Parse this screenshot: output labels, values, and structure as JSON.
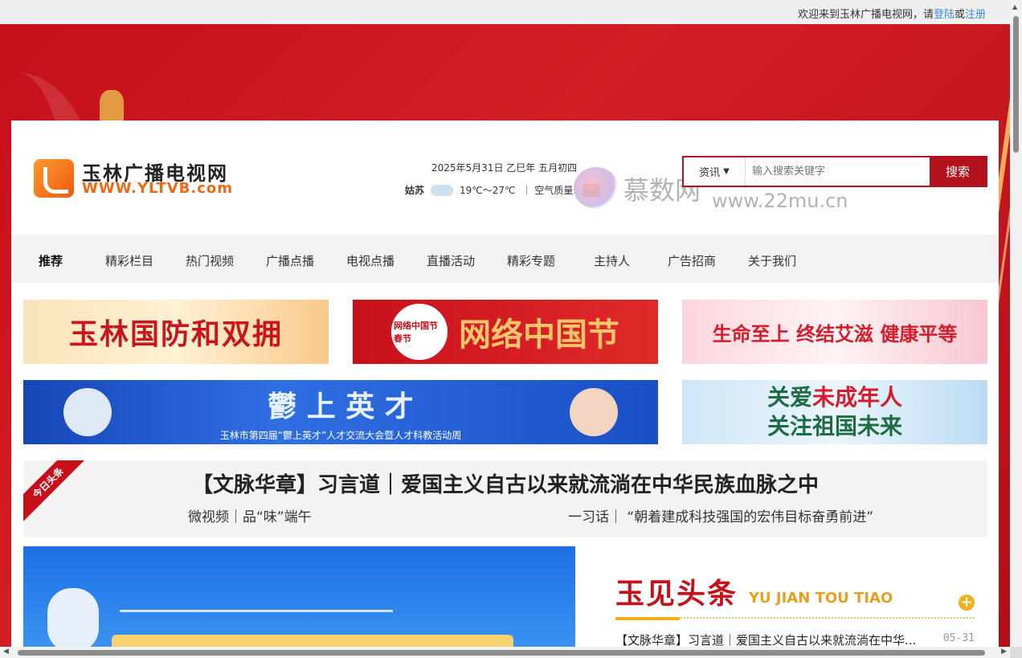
{
  "topbar": {
    "welcome_prefix": "欢迎来到玉林广播电视网，请",
    "login": "登陆",
    "or": "或",
    "register": "注册"
  },
  "logo": {
    "name_cn": "玉林广播电视网",
    "name_en": "WWW.YLTVB.com"
  },
  "date_info": {
    "date": "2025年5月31日  乙巳年  五月初四"
  },
  "weather": {
    "city": "姑苏",
    "temp": "19℃～27℃",
    "aq_label": "｜ 空气质量:"
  },
  "watermark": {
    "cn": "慕数网",
    "url": "www.22mu.cn"
  },
  "search": {
    "category": "资讯",
    "placeholder": "输入搜索关键字",
    "button": "搜索"
  },
  "nav": {
    "items": [
      "推荐",
      "精彩栏目",
      "热门视频",
      "广播点播",
      "电视点播",
      "直播活动",
      "精彩专题",
      "主持人",
      "广告招商",
      "关于我们"
    ]
  },
  "banners": {
    "b1": "玉林国防和双拥",
    "b2": "网络中国节",
    "b2_seal": "网络中国节 春节",
    "b3": "生命至上  终结艾滋  健康平等",
    "b4_title": "鬱  上  英  才",
    "b4_sub": "玉林市第四届“鬱上英才”人才交流大会暨人才科教活动周",
    "b5_line1_a": "关爱",
    "b5_line1_b": "未成年人",
    "b5_line2": "关注祖国未来"
  },
  "headline": {
    "ribbon": "今日头条",
    "title": "【文脉华章】习言道｜爱国主义自古以来就流淌在中华民族血脉之中",
    "sub_left": "微视频｜品“味”端午",
    "sub_right": "一习话｜ “朝着建成科技强国的宏伟目标奋勇前进”"
  },
  "side": {
    "title_cn": "玉见头条",
    "title_en": "YU JIAN TOU TIAO",
    "items": [
      {
        "title": "【文脉华章】习言道｜爱国主义自古以来就流淌在中华...",
        "date": "05-31"
      }
    ]
  },
  "colors": {
    "brand_red": "#b1121c",
    "accent_orange": "#f06a14",
    "link_blue": "#3a8ee6"
  }
}
